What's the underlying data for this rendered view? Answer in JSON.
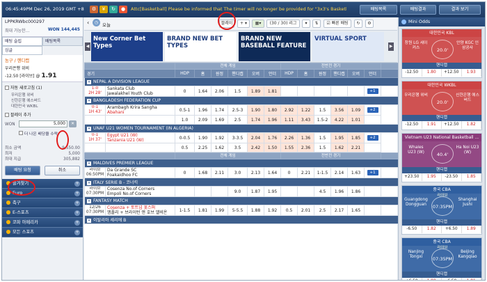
{
  "topbar": {
    "clock": "06:45:49PM Dec 26, 2019 GMT +8",
    "notice": "Attc[Basketball] Please be informed that The timer will no longer be provided for \"3x3's Basketball Game\". Sorry for the",
    "btn_betlist": "배팅목록",
    "btn_result": "배팅결과",
    "btn_result_view": "결과 보기"
  },
  "user": {
    "id": "LPPKRWbc000297",
    "avail_label": "최대 가능한...",
    "balance": "WON 144,445"
  },
  "left_tabs": {
    "slip": "배팅 슬립",
    "list": "배팅목록",
    "single": "싱글"
  },
  "slip": {
    "selection": "농구 / 핸디캡",
    "team": "우리은행 위비",
    "line": "-12.50",
    "live": "[라이브]",
    "at": "@",
    "odds": "1.91",
    "auto_accept": "자동 새로고침 (1)",
    "games": [
      "우리은행 위비",
      "신한은행 에스버드",
      "대한민국 WKBL"
    ],
    "add_bet": "팔레이 추가",
    "won_label": "WON",
    "amount": "5,000",
    "better_odds": "더 나은 배당을 수락",
    "stats": [
      {
        "k": "최소 금액",
        "v": "9,550.00"
      },
      {
        "k": "최저",
        "v": "5,000"
      },
      {
        "k": "최대 지급",
        "v": "305,882"
      }
    ],
    "bet_btn": "배팅 요청",
    "cancel_btn": "취소"
  },
  "left_cats": [
    "즐겨찾기",
    "Euro",
    "축구",
    "E-스포츠",
    "코파 아메리카",
    "모든 스포츠"
  ],
  "subbar": {
    "today": "오늘",
    "parlay": "팔레이",
    "counter": "(30 / 30) 리그",
    "quick": "빠른 배팅"
  },
  "banners": [
    {
      "text": "New Corner Bet Types"
    },
    {
      "text": "BRAND NEW BET TYPES"
    },
    {
      "text": "BRAND NEW BASEBALL FEATURE"
    },
    {
      "text": "VIRTUAL SPORT"
    }
  ],
  "table": {
    "group_live": "전체 게임",
    "group_half": "전반전 경기",
    "col_game": "경기",
    "headers": [
      "HDP",
      "홈",
      "원정",
      "핸디캡",
      "오버",
      "언더",
      "1",
      "X",
      "2"
    ]
  },
  "rows_a": [
    {
      "league": "NEPAL A DIVISION LEAGUE"
    },
    {
      "time1": "1-0",
      "time2": "2H 28'",
      "home": "Sankata Club",
      "away": "Jawalakhel Youth Club",
      "hdp": "0",
      "h": "1.64",
      "a": "2.06",
      "ou": "1.5",
      "o": "1.89",
      "u": "1.81",
      "hh": "",
      "hx": "",
      "ha": "",
      "more": "+1"
    },
    {
      "league": "BANGLADESH FEDERATION CUP"
    },
    {
      "time1": "0-1",
      "time2": "1H 43'",
      "home": "Arambagh Krira Sangha",
      "away": "Abahani",
      "hdp": "0.5-1",
      "h": "1.96",
      "a": "1.74",
      "ou": "2.5-3",
      "o": "1.90",
      "u": "1.80",
      "hh": "2.92",
      "hx": "1.22",
      "ha": "1.5",
      "o2": "3.56",
      "u2": "1.09",
      "more": "+2"
    },
    {
      "time1": "",
      "time2": "",
      "home": "",
      "away": "",
      "hdp": "1.0",
      "h": "2.09",
      "a": "1.69",
      "ou": "2.5",
      "o": "1.74",
      "u": "1.96",
      "hh": "1.11",
      "hx": "3.43",
      "ha": "1.5-2",
      "o2": "4.22",
      "u2": "1.01"
    },
    {
      "league": "UNAF U21 WOMEN TOURNAMENT (IN ALGERIA)"
    },
    {
      "time1": "0-1",
      "time2": "1H 37'",
      "home": "Egypt U21 (W)",
      "away": "Tanzania U21 (W)",
      "hdp": "0-0.5",
      "h": "1.90",
      "a": "1.92",
      "ou": "3-3.5",
      "o": "2.04",
      "u": "1.76",
      "hh": "2.26",
      "hx": "1.36",
      "ha": "1.5",
      "o2": "1.95",
      "u2": "1.85",
      "more": "+2"
    },
    {
      "time1": "",
      "time2": "",
      "home": "",
      "away": "",
      "hdp": "0.5",
      "h": "2.25",
      "a": "1.62",
      "ou": "3.5",
      "o": "2.42",
      "u": "1.50",
      "hh": "1.55",
      "hx": "2.36",
      "ha": "1.5",
      "o2": "1.62",
      "u2": "2.21"
    }
  ],
  "rows_b": [
    {
      "league": "MALDIVES PREMIER LEAGUE"
    },
    {
      "time1": "라이브",
      "time2": "06:50PM",
      "home": "Da Grande SC",
      "away": "Foakaidhoo FC",
      "hdp": "0",
      "h": "1.68",
      "a": "2.11",
      "ou": "3.0",
      "o": "2.13",
      "u": "1.64",
      "hh": "0",
      "hx": "2.21",
      "ha": "1-1.5",
      "o2": "2.14",
      "u2": "1.63",
      "more": "+1"
    },
    {
      "league": "ITALY SERIE B - 코너킥"
    },
    {
      "time1": "라이브",
      "time2": "07:30PM",
      "home": "Cosenza No.of Corners",
      "away": "Empoli No.of Corners",
      "hdp": "",
      "h": "",
      "a": "",
      "ou": "9.0",
      "o": "1.87",
      "u": "1.95",
      "hh": "",
      "hx": "",
      "ha": "4.5",
      "o2": "1.96",
      "u2": "1.86"
    },
    {
      "league": "FANTASY MATCH"
    },
    {
      "time1": "12/26",
      "time2": "07:30PM",
      "home": "Cosenza + 토트넘 홋스퍼",
      "away": "엠폴리 + 브라이턴 앤 호브 앨비온",
      "hdp": "1-1.5",
      "h": "1.81",
      "a": "1.99",
      "ou": "5-5.5",
      "o": "1.88",
      "u": "1.92",
      "hh": "0.5",
      "hx": "2.01",
      "ha": "2.5",
      "o2": "2.17",
      "u2": "1.65"
    },
    {
      "league": "이탈리아 세리에 B"
    }
  ],
  "mini_odds": {
    "title": "Mini Odds",
    "cards": [
      {
        "league": "대한민국 KBL",
        "home": "창원 LG 세이커스",
        "away": "안양 KGC 인삼공사",
        "center": "20.0'",
        "market": "핸디캡",
        "odds": [
          "-12.50",
          "1.80",
          "+12.50",
          "1.93"
        ],
        "color": "#c44"
      },
      {
        "league": "대한민국 WKBL",
        "home": "우리은행 위비",
        "away": "신한은행 에스버드",
        "center": "20.0'",
        "market": "핸디캡",
        "odds": [
          "-12.50",
          "1.91",
          "+12.50",
          "1.82"
        ],
        "color": "#c44"
      },
      {
        "league": "Vietnam U23 National Basketball ...",
        "home": "Whales U23 (W)",
        "away": "Ha Noi U23 (W)",
        "center": "40.4'",
        "market": "핸디캡",
        "odds": [
          "+23.50",
          "1.95",
          "-23.50",
          "1.85"
        ],
        "color": "#8a3a7a"
      },
      {
        "league": "중국 CBA",
        "home": "Guangdong Dongguan",
        "away": "Shanghai Jushi",
        "center": "07:35PM",
        "live": "라이브",
        "market": "핸디캡",
        "odds": [
          "-6.50",
          "1.82",
          "+6.50",
          "1.89"
        ],
        "color": "#2f5fa0"
      },
      {
        "league": "중국 CBA",
        "home": "Nanjing Tongxi",
        "away": "Beijing Kangqiao",
        "center": "07:35PM",
        "live": "라이브",
        "market": "핸디캡",
        "odds": [
          "+6.50",
          "1.90",
          "-6.50",
          "1.81"
        ],
        "color": "#2f5fa0"
      }
    ]
  },
  "colors": {
    "accent": "#2c4f7c",
    "highlight": "#ffe4d8",
    "annotation": "#e21c1c"
  }
}
